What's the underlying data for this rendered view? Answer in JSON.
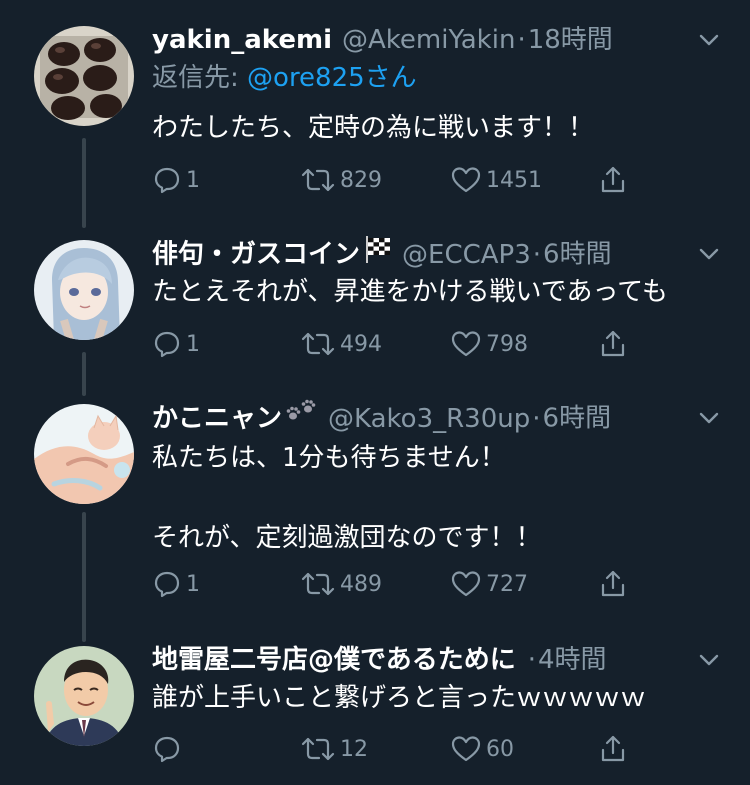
{
  "tweets": [
    {
      "name": "yakin_akemi",
      "handle": "@AkemiYakin",
      "separator": "·",
      "time": "18時間",
      "reply_prefix": "返信先: ",
      "reply_mention": "@ore825さん",
      "text": "わたしたち、定時の為に戦います！！",
      "replies": "1",
      "retweets": "829",
      "likes": "1451"
    },
    {
      "name": "俳句・ガスコイン",
      "name_emoji": "chequered-flag-icon",
      "handle": "@ECCAP3",
      "separator": "·",
      "time": "6時間",
      "text": "たとえそれが、昇進をかける戦いであっても",
      "replies": "1",
      "retweets": "494",
      "likes": "798"
    },
    {
      "name": "かこニャン",
      "name_emoji": "paw-prints-icon",
      "handle": "@Kako3_R30up",
      "separator": "·",
      "time": "6時間",
      "text": "私たちは、1分も待ちません！\n\nそれが、定刻過激団なのです！！",
      "replies": "1",
      "retweets": "489",
      "likes": "727"
    },
    {
      "name": "地雷屋二号店@僕であるために",
      "handle": "",
      "separator": "·",
      "time": "4時間",
      "text": "誰が上手いこと繋げろと言ったｗｗｗｗｗ",
      "replies": "",
      "retweets": "12",
      "likes": "60"
    }
  ],
  "colors": {
    "background": "#15202b",
    "secondary_text": "#8899a6",
    "link": "#1da1f2",
    "thread_line": "#38444d"
  }
}
